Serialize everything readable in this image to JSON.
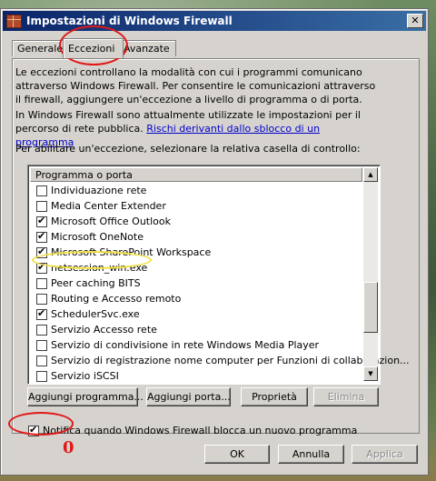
{
  "window": {
    "title": "Impostazioni di Windows Firewall",
    "close_glyph": "✕"
  },
  "tabs": [
    {
      "label": "Generale",
      "active": false
    },
    {
      "label": "Eccezioni",
      "active": true
    },
    {
      "label": "Avanzate",
      "active": false
    }
  ],
  "intro": {
    "paragraph1": "Le eccezioni controllano la modalità con cui i programmi comunicano attraverso Windows Firewall. Per consentire le comunicazioni attraverso il firewall, aggiungere un'eccezione a livello di programma o di porta.",
    "paragraph2": "In Windows Firewall sono attualmente utilizzate le impostazioni per il percorso di rete pubblica.",
    "risks_link": "Rischi derivanti dallo sblocco di un programma",
    "instruction": "Per abilitare un'eccezione, selezionare la relativa casella di controllo:"
  },
  "list": {
    "header": "Programma o porta",
    "items": [
      {
        "label": "Individuazione rete",
        "checked": false
      },
      {
        "label": "Media Center Extender",
        "checked": false
      },
      {
        "label": "Microsoft Office Outlook",
        "checked": true
      },
      {
        "label": "Microsoft OneNote",
        "checked": true
      },
      {
        "label": "Microsoft SharePoint Workspace",
        "checked": true
      },
      {
        "label": "netsession_win.exe",
        "checked": true
      },
      {
        "label": "Peer caching BITS",
        "checked": false
      },
      {
        "label": "Routing e Accesso remoto",
        "checked": false
      },
      {
        "label": "SchedulerSvc.exe",
        "checked": true
      },
      {
        "label": "Servizio Accesso rete",
        "checked": false
      },
      {
        "label": "Servizio di condivisione in rete Windows Media Player",
        "checked": false
      },
      {
        "label": "Servizio di registrazione nome computer per Funzioni di collaborazion...",
        "checked": false
      },
      {
        "label": "Servizio iSCSI",
        "checked": false
      }
    ]
  },
  "buttons": {
    "add_program": "Aggiungi programma...",
    "add_port": "Aggiungi porta...",
    "properties": "Proprietà",
    "delete": "Elimina",
    "ok": "OK",
    "cancel": "Annulla",
    "apply": "Applica"
  },
  "notify": {
    "label": "Notifica quando Windows Firewall blocca un nuovo programma",
    "checked": true
  },
  "annotation": {
    "zero_mark": "0"
  }
}
